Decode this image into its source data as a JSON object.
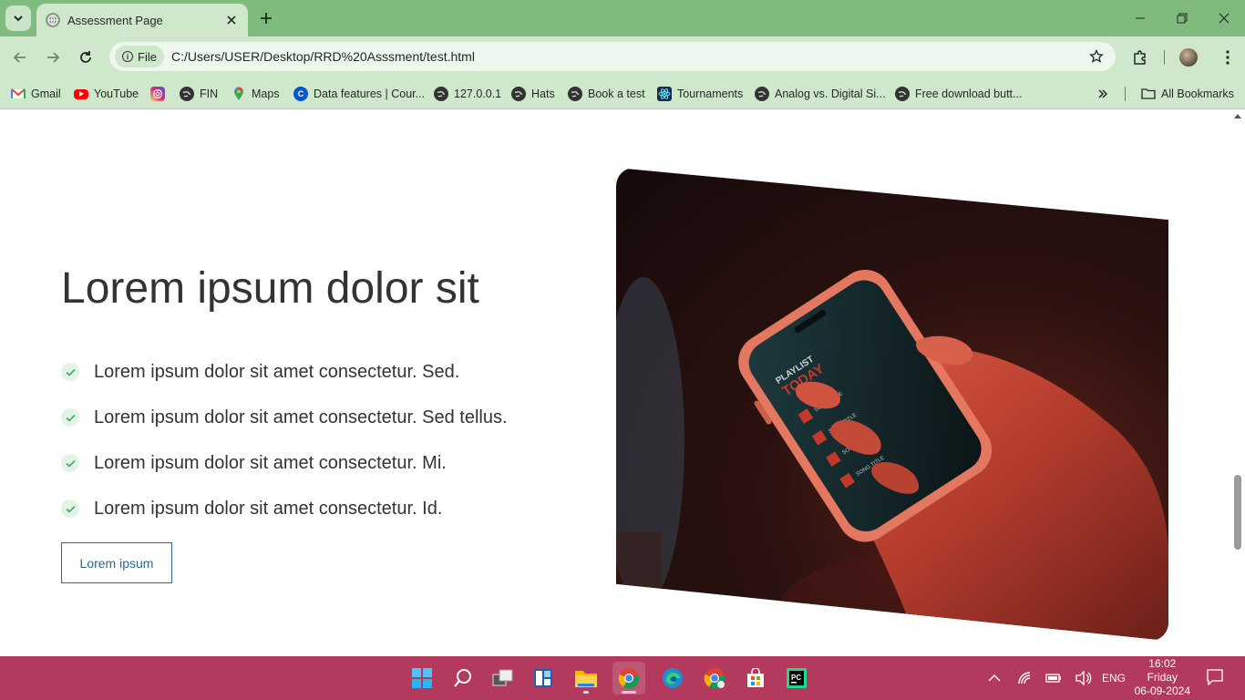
{
  "browser": {
    "tab": {
      "title": "Assessment Page"
    },
    "omnibox": {
      "scheme_label": "File",
      "url": "C:/Users/USER/Desktop/RRD%20Asssment/test.html"
    },
    "bookmarks": [
      {
        "label": "Gmail",
        "icon": "gmail-icon",
        "color": "#ea4335"
      },
      {
        "label": "YouTube",
        "icon": "youtube-icon",
        "color": "#ff0000"
      },
      {
        "label": "",
        "icon": "instagram-icon",
        "color": "#d6249f"
      },
      {
        "label": "FIN",
        "icon": "globe-icon",
        "color": "#333333"
      },
      {
        "label": "Maps",
        "icon": "maps-icon",
        "color": "#34a853"
      },
      {
        "label": "Data features | Cour...",
        "icon": "coursera-icon",
        "color": "#0056d2"
      },
      {
        "label": "127.0.0.1",
        "icon": "globe-icon",
        "color": "#333333"
      },
      {
        "label": "Hats",
        "icon": "globe-icon",
        "color": "#333333"
      },
      {
        "label": "Book a test",
        "icon": "globe-icon",
        "color": "#333333"
      },
      {
        "label": "Tournaments",
        "icon": "react-icon",
        "color": "#1b2a4a"
      },
      {
        "label": "Analog vs. Digital Si...",
        "icon": "globe-icon",
        "color": "#333333"
      },
      {
        "label": "Free download butt...",
        "icon": "globe-icon",
        "color": "#333333"
      }
    ],
    "all_bookmarks": "All Bookmarks"
  },
  "page": {
    "heading": "Lorem ipsum dolor sit",
    "features": [
      "Lorem ipsum dolor sit amet consectetur. Sed.",
      "Lorem ipsum dolor sit amet consectetur. Sed tellus.",
      "Lorem ipsum dolor sit amet consectetur. Mi.",
      "Lorem ipsum dolor sit amet consectetur. Id."
    ],
    "button": "Lorem ipsum",
    "accent": "#2d6a8a",
    "check_color": "#3fa86b"
  },
  "phone_screen": {
    "title_line1": "PLAYLIST",
    "title_line2": "TODAY",
    "songs": [
      "SONG TITLE",
      "SONG TITLE",
      "SONG TITLE",
      "SONG TITLE"
    ]
  },
  "taskbar": {
    "lang": "ENG",
    "time": "16:02",
    "day": "Friday",
    "date": "06-09-2024",
    "color": "#b3395d"
  }
}
